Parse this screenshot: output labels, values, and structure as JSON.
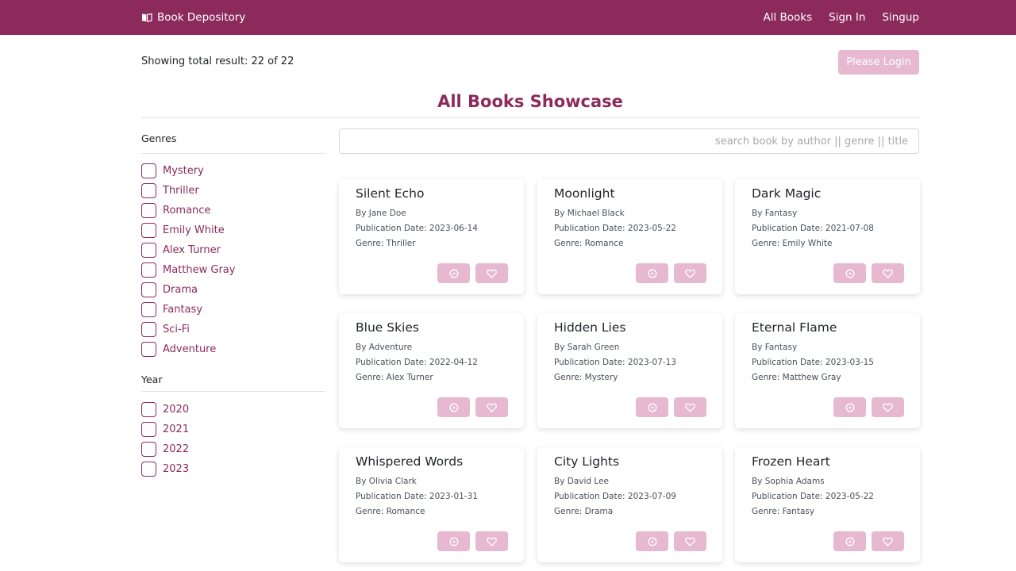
{
  "navbar": {
    "brand": "Book Depository",
    "brand_icon": "book-icon",
    "links": [
      "All Books",
      "Sign In",
      "Singup"
    ],
    "color": "#8c2a5c"
  },
  "result_text": "Showing total result: 22 of 22",
  "login_button": "Please Login",
  "page_title": "All Books Showcase",
  "search": {
    "placeholder": "search book by author || genre || title",
    "value": ""
  },
  "filters": {
    "genres": {
      "heading": "Genres",
      "items": [
        "Mystery",
        "Thriller",
        "Romance",
        "Emily White",
        "Alex Turner",
        "Matthew Gray",
        "Drama",
        "Fantasy",
        "Sci-Fi",
        "Adventure"
      ]
    },
    "year": {
      "heading": "Year",
      "items": [
        "2020",
        "2021",
        "2022",
        "2023"
      ]
    }
  },
  "books": [
    {
      "title": "Silent Echo",
      "author": "By Jane Doe",
      "date": "Publication Date: 2023-06-14",
      "genre": "Genre: Thriller"
    },
    {
      "title": "Moonlight",
      "author": "By Michael Black",
      "date": "Publication Date: 2023-05-22",
      "genre": "Genre: Romance"
    },
    {
      "title": "Dark Magic",
      "author": "By Fantasy",
      "date": "Publication Date: 2021-07-08",
      "genre": "Genre: Emily White"
    },
    {
      "title": "Blue Skies",
      "author": "By Adventure",
      "date": "Publication Date: 2022-04-12",
      "genre": "Genre: Alex Turner"
    },
    {
      "title": "Hidden Lies",
      "author": "By Sarah Green",
      "date": "Publication Date: 2023-07-13",
      "genre": "Genre: Mystery"
    },
    {
      "title": "Eternal Flame",
      "author": "By Fantasy",
      "date": "Publication Date: 2023-03-15",
      "genre": "Genre: Matthew Gray"
    },
    {
      "title": "Whispered Words",
      "author": "By Olivia Clark",
      "date": "Publication Date: 2023-01-31",
      "genre": "Genre: Romance"
    },
    {
      "title": "City Lights",
      "author": "By David Lee",
      "date": "Publication Date: 2023-07-09",
      "genre": "Genre: Drama"
    },
    {
      "title": "Frozen Heart",
      "author": "By Sophia Adams",
      "date": "Publication Date: 2023-05-22",
      "genre": "Genre: Fantasy"
    }
  ],
  "card_buttons": {
    "view_icon": "view-icon",
    "favorite_icon": "heart-icon"
  }
}
